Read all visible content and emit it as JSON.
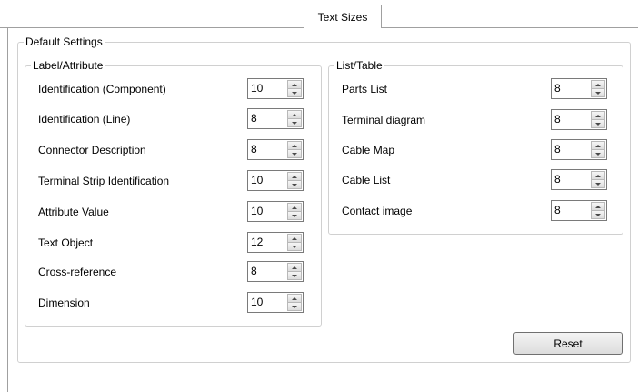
{
  "tab": {
    "label": "Text Sizes"
  },
  "default_settings": {
    "title": "Default Settings",
    "label_attribute": {
      "title": "Label/Attribute",
      "rows": [
        {
          "label": "Identification (Component)",
          "value": "10"
        },
        {
          "label": "Identification (Line)",
          "value": "8"
        },
        {
          "label": "Connector Description",
          "value": "8"
        },
        {
          "label": "Terminal Strip Identification",
          "value": "10"
        },
        {
          "label": "Attribute Value",
          "value": "10"
        },
        {
          "label": "Text Object",
          "value": "12"
        },
        {
          "label": "Cross-reference",
          "value": "8"
        },
        {
          "label": "Dimension",
          "value": "10"
        }
      ]
    },
    "list_table": {
      "title": "List/Table",
      "rows": [
        {
          "label": "Parts List",
          "value": "8"
        },
        {
          "label": "Terminal diagram",
          "value": "8"
        },
        {
          "label": "Cable Map",
          "value": "8"
        },
        {
          "label": "Cable List",
          "value": "8"
        },
        {
          "label": "Contact image",
          "value": "8"
        }
      ]
    }
  },
  "reset_label": "Reset"
}
